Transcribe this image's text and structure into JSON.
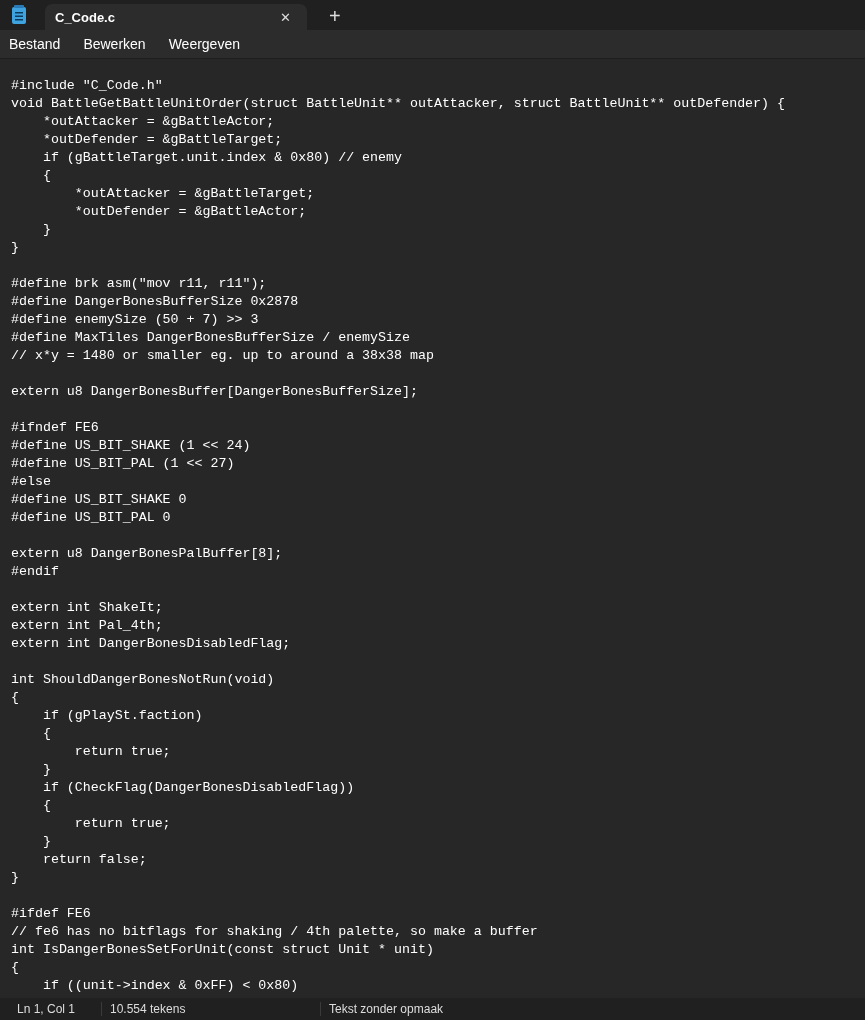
{
  "tab": {
    "title": "C_Code.c",
    "selected": true,
    "close": "✕"
  },
  "new_tab": "+",
  "menu": [
    "Bestand",
    "Bewerken",
    "Weergeven"
  ],
  "blocks": [
    [
      "#include \"C_Code.h\"",
      "void BattleGetBattleUnitOrder(struct BattleUnit** outAttacker, struct BattleUnit** outDefender) {",
      "    *outAttacker = &gBattleActor;",
      "    *outDefender = &gBattleTarget;",
      "    if (gBattleTarget.unit.index & 0x80) // enemy",
      "    {",
      "        *outAttacker = &gBattleTarget;",
      "        *outDefender = &gBattleActor;",
      "    }",
      "}"
    ],
    [
      "#define brk asm(\"mov r11, r11\");",
      "#define DangerBonesBufferSize 0x2878",
      "#define enemySize (50 + 7) >> 3",
      "#define MaxTiles DangerBonesBufferSize / enemySize",
      "// x*y = 1480 or smaller eg. up to around a 38x38 map"
    ],
    [
      "extern u8 DangerBonesBuffer[DangerBonesBufferSize];"
    ],
    [
      "#ifndef FE6",
      "#define US_BIT_SHAKE (1 << 24)",
      "#define US_BIT_PAL (1 << 27)",
      "#else",
      "#define US_BIT_SHAKE 0",
      "#define US_BIT_PAL 0"
    ],
    [
      "extern u8 DangerBonesPalBuffer[8];",
      "#endif"
    ],
    [
      "extern int ShakeIt;",
      "extern int Pal_4th;",
      "extern int DangerBonesDisabledFlag;"
    ],
    [
      "int ShouldDangerBonesNotRun(void)",
      "{",
      "    if (gPlaySt.faction)",
      "    {",
      "        return true;",
      "    }",
      "    if (CheckFlag(DangerBonesDisabledFlag))",
      "    {",
      "        return true;",
      "    }",
      "    return false;",
      "}"
    ],
    [
      "#ifdef FE6",
      "// fe6 has no bitflags for shaking / 4th palette, so make a buffer",
      "int IsDangerBonesSetForUnit(const struct Unit * unit)",
      "{",
      "    if ((unit->index & 0xFF) < 0x80)"
    ]
  ],
  "status_bar": [
    "Ln 1, Col 1",
    "10.554 tekens",
    "Tekst zonder opmaak"
  ]
}
